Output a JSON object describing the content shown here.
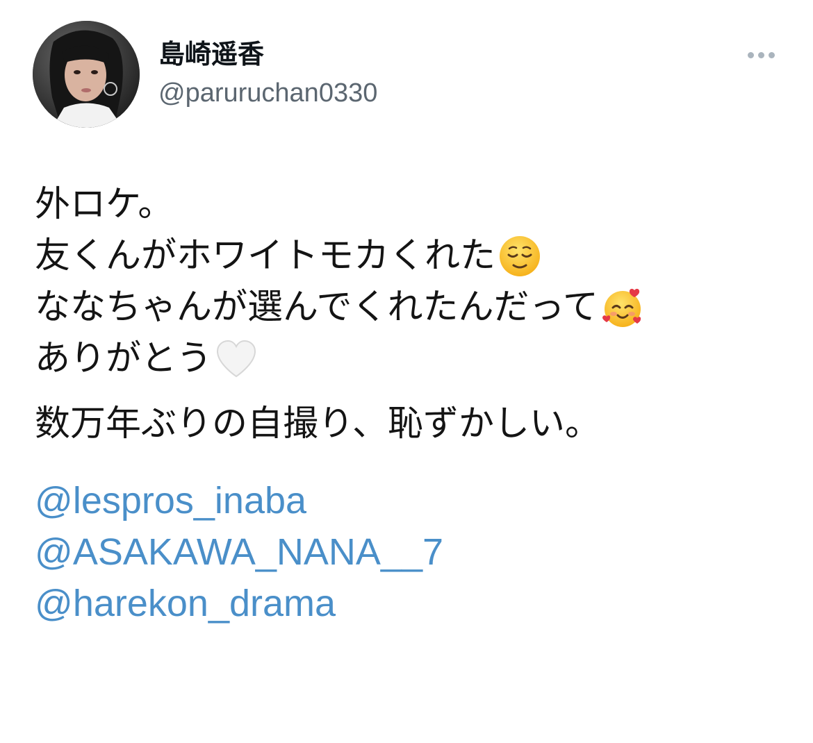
{
  "user": {
    "display_name": "島崎遥香",
    "handle": "@paruruchan0330",
    "avatar_icon": "avatar-photo"
  },
  "more_button": {
    "icon": "more-horizontal-icon"
  },
  "tweet": {
    "lines": [
      "外ロケ。",
      "友くんがホワイトモカくれた",
      "ななちゃんが選んでくれたんだって",
      "ありがとう",
      "数万年ぶりの自撮り、恥ずかしい。"
    ],
    "emojis": [
      "relieved-face-emoji",
      "smiling-face-with-hearts-emoji",
      "white-heart-emoji"
    ],
    "mentions": [
      "@lespros_inaba",
      "@ASAKAWA_NANA__7",
      "@harekon_drama"
    ]
  },
  "colors": {
    "mention": "#4a8fc9",
    "handle": "#5b6670",
    "text": "#141414"
  }
}
